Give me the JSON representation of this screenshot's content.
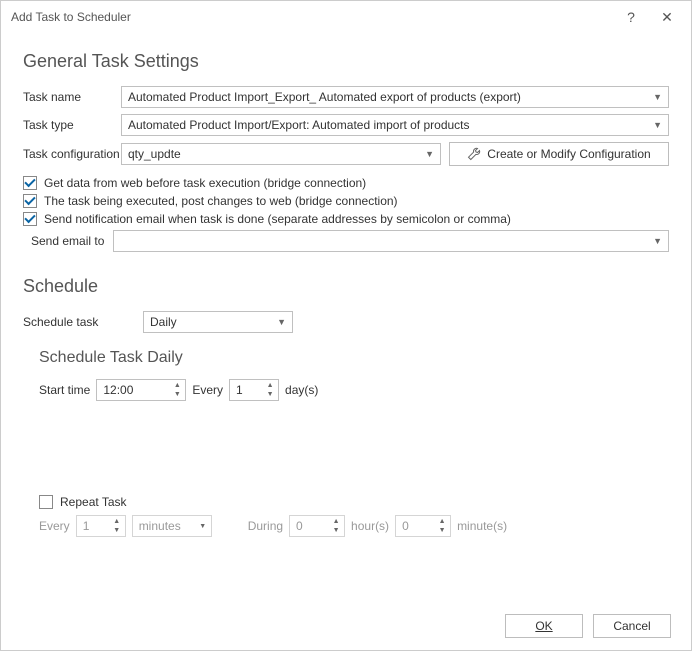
{
  "window": {
    "title": "Add Task to Scheduler"
  },
  "sections": {
    "general": "General Task Settings",
    "schedule": "Schedule",
    "schedule_daily": "Schedule Task Daily"
  },
  "labels": {
    "task_name": "Task name",
    "task_type": "Task type",
    "task_config": "Task configuration",
    "send_email_to": "Send email to",
    "schedule_task": "Schedule task",
    "start_time": "Start time",
    "every": "Every",
    "days": "day(s)",
    "repeat_task": "Repeat Task",
    "during": "During",
    "hours": "hour(s)",
    "minutes_unit": "minute(s)"
  },
  "values": {
    "task_name": "Automated Product Import_Export_ Automated export of products (export)",
    "task_type": "Automated Product Import/Export: Automated import of products",
    "task_config": "qty_updte",
    "send_email_to": "",
    "schedule_task": "Daily",
    "start_time": "12:00",
    "every_days": "1",
    "repeat_every": "1",
    "repeat_unit": "minutes",
    "during_hours": "0",
    "during_minutes": "0"
  },
  "buttons": {
    "create_modify_config": "Create or Modify Configuration",
    "ok": "OK",
    "cancel": "Cancel"
  },
  "checkboxes": {
    "get_data": "Get data from web before task execution (bridge connection)",
    "post_changes": "The task being executed, post changes to web (bridge connection)",
    "send_notification": "Send notification email when task is done (separate addresses by semicolon or comma)"
  }
}
